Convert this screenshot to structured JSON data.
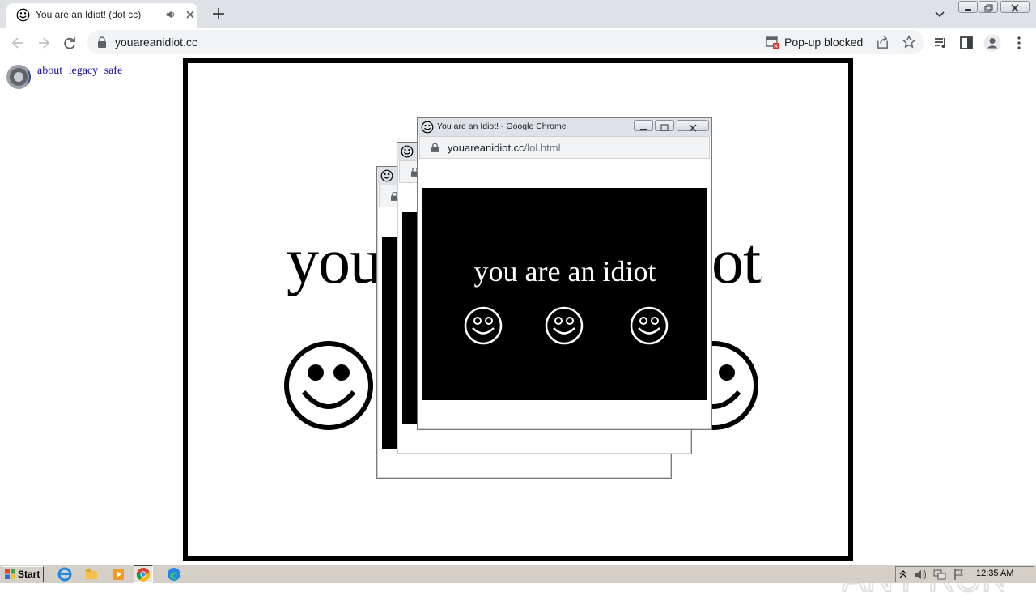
{
  "browser": {
    "tab_title": "You are an Idiot! (dot cc)",
    "url": "youareanidiot.cc",
    "popup_blocked_text": "Pop-up blocked"
  },
  "page": {
    "links": [
      "about",
      "legacy",
      "safe"
    ],
    "big_text_left": "you",
    "big_text_right": "ot",
    "big_text_tail": "!"
  },
  "popup_window": {
    "title": "You are an Idiot! - Google Chrome",
    "url_domain": "youareanidiot.cc",
    "url_path": "/lol.html",
    "message": "you are an idiot"
  },
  "taskbar": {
    "start_label": "Start",
    "clock": "12:35 AM"
  },
  "watermark": "ANY RUN",
  "colors": {
    "tab_strip": "#dee1e6",
    "omnibox": "#f1f3f4",
    "taskbar": "#d4d0c8",
    "link": "#1a0dab"
  }
}
